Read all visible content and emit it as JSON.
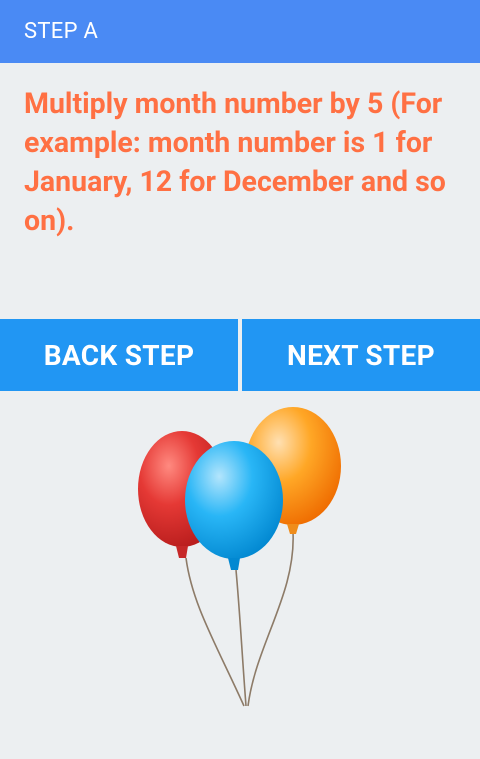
{
  "app_bar": {
    "title": "STEP A",
    "color": "#4a8af4"
  },
  "instruction": {
    "text": "Multiply month number by 5 (For example: month number is 1 for January, 12 for December and so on).",
    "color": "#ff7043"
  },
  "buttons": {
    "back_label": "BACK STEP",
    "next_label": "NEXT STEP",
    "color": "#2196f3"
  },
  "illustration": {
    "icon": "balloons-icon",
    "balloon_colors": [
      "#e53935",
      "#29b6f6",
      "#ffa726"
    ]
  }
}
